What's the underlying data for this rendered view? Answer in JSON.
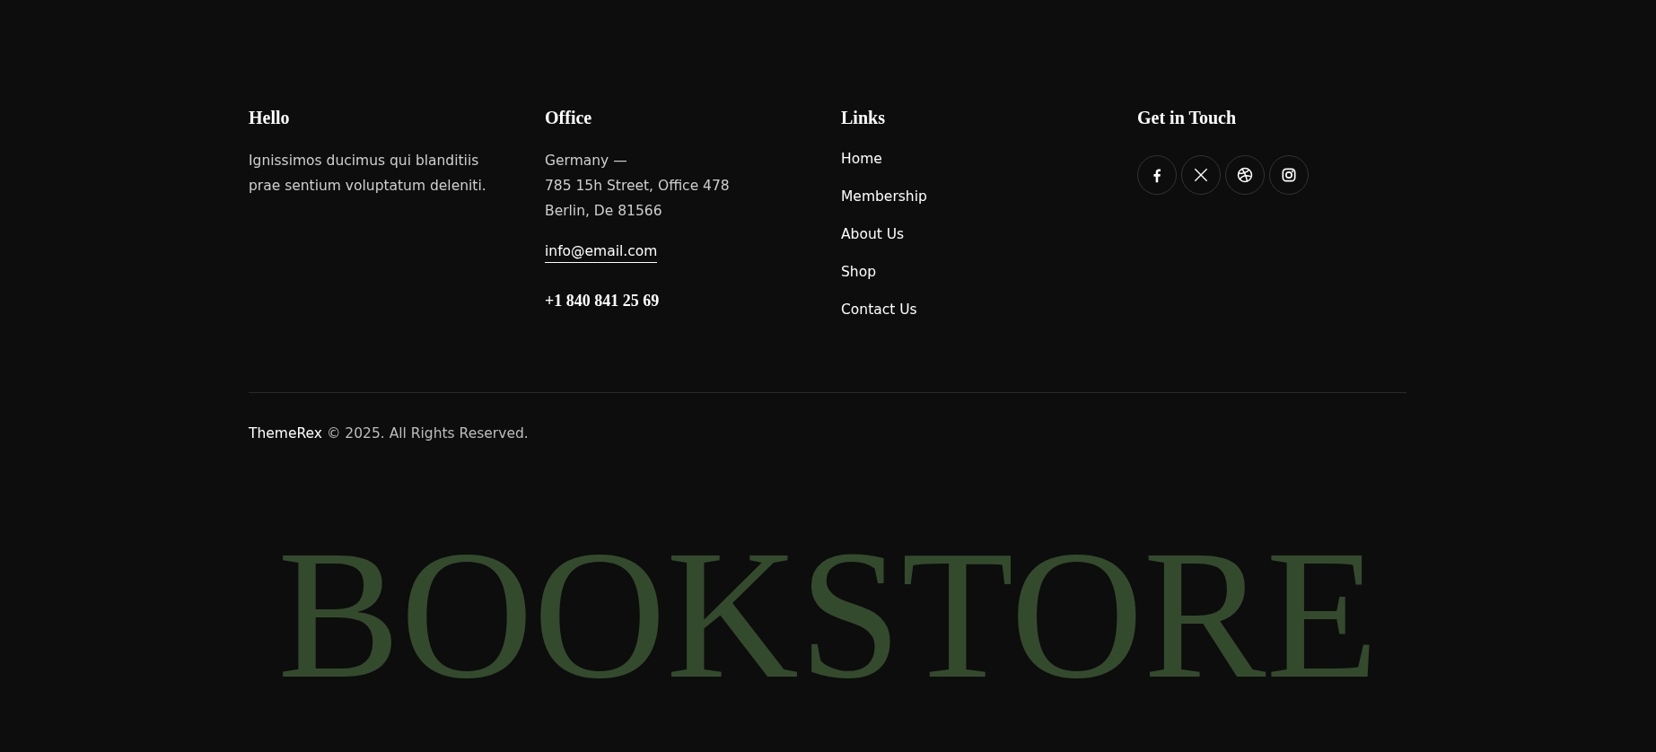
{
  "columns": [
    {
      "kind": "text",
      "title": "Hello",
      "lines": [
        "Ignissimos ducimus qui blanditiis prae sentium voluptatum deleniti."
      ]
    },
    {
      "kind": "office",
      "title": "Office",
      "lines": [
        "Germany —",
        "785 15h Street, Office 478",
        "Berlin, De 81566"
      ],
      "email": "info@email.com",
      "phone": "+1 840 841 25 69"
    },
    {
      "kind": "links",
      "title": "Links",
      "links": [
        "Home",
        "Membership",
        "About Us",
        "Shop",
        "Contact Us"
      ]
    },
    {
      "kind": "social",
      "title": "Get in Touch",
      "icons": [
        {
          "kind": "facebook"
        },
        {
          "kind": "x"
        },
        {
          "kind": "dribbble"
        },
        {
          "kind": "instagram"
        }
      ]
    }
  ],
  "copyright": {
    "brand": "ThemeRex",
    "text": "© 2025. All Rights Reserved."
  },
  "wordmark": "BOOKSTORE"
}
